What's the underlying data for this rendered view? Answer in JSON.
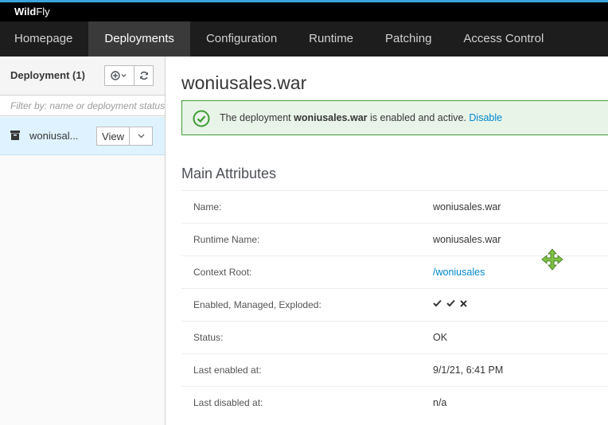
{
  "app": {
    "brand_bold": "Wild",
    "brand_light": "Fly"
  },
  "nav": {
    "items": [
      {
        "label": "Homepage"
      },
      {
        "label": "Deployments"
      },
      {
        "label": "Configuration"
      },
      {
        "label": "Runtime"
      },
      {
        "label": "Patching"
      },
      {
        "label": "Access Control"
      }
    ],
    "active": "Deployments"
  },
  "sidebar": {
    "title": "Deployment (1)",
    "filter_placeholder": "Filter by: name or deployment status",
    "items": [
      {
        "name": "woniusal...",
        "view_label": "View"
      }
    ]
  },
  "main": {
    "title": "woniusales.war",
    "alert": {
      "prefix": "The deployment ",
      "name": "woniusales.war",
      "suffix": " is enabled and active.",
      "link": "Disable"
    },
    "section_title": "Main Attributes",
    "attributes": [
      {
        "label": "Name:",
        "value": "woniusales.war"
      },
      {
        "label": "Runtime Name:",
        "value": "woniusales.war"
      },
      {
        "label": "Context Root:",
        "value": "/woniusales"
      },
      {
        "label": "Enabled, Managed, Exploded:",
        "value": ""
      },
      {
        "label": "Status:",
        "value": "OK"
      },
      {
        "label": "Last enabled at:",
        "value": "9/1/21, 6:41 PM"
      },
      {
        "label": "Last disabled at:",
        "value": "n/a"
      }
    ],
    "flags": [
      "check-icon",
      "check-icon",
      "x-icon"
    ]
  },
  "colors": {
    "accent": "#0088ce",
    "success": "#3f9c35",
    "selected_bg": "#def3ff",
    "nav_bg": "#1d1d1d",
    "cursor": "#7dc242"
  }
}
